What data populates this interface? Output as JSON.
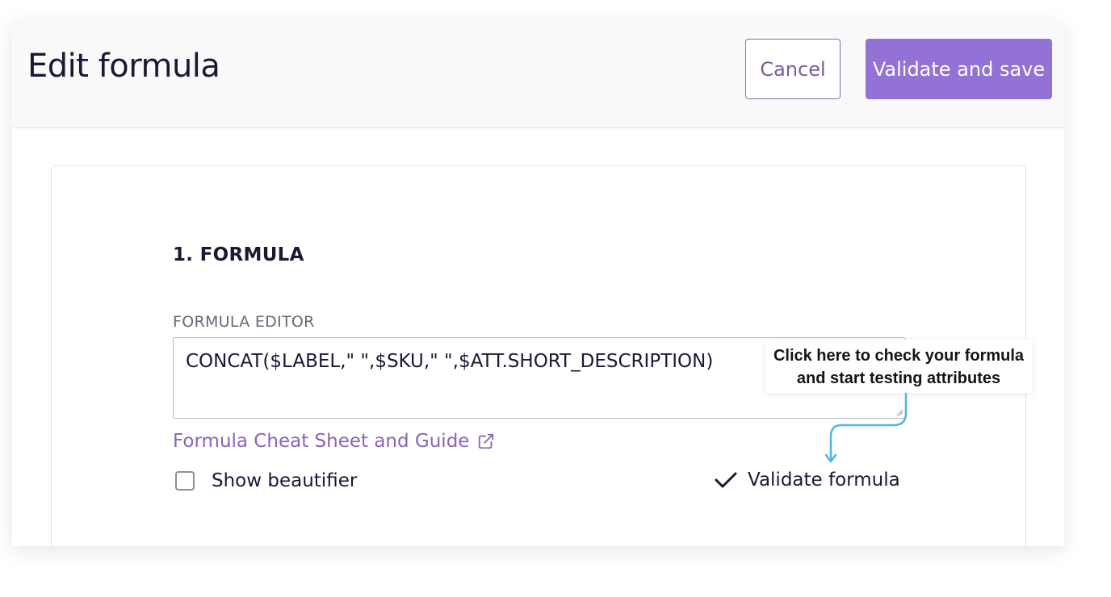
{
  "header": {
    "title": "Edit formula",
    "cancel_label": "Cancel",
    "save_label": "Validate and save"
  },
  "formula_section": {
    "title": "1. FORMULA",
    "editor_label": "FORMULA EDITOR",
    "editor_value": "CONCAT($LABEL,\" \",$SKU,\" \",$ATT.SHORT_DESCRIPTION)",
    "guide_link": "Formula Cheat Sheet and Guide",
    "guide_icon": "external-link-icon",
    "beautifier_label": "Show beautifier",
    "beautifier_checked": false,
    "validate_label": "Validate formula",
    "validate_icon": "check-icon"
  },
  "callout": {
    "line1": "Click here to check your formula",
    "line2": "and start testing attributes"
  },
  "colors": {
    "accent": "#9272d6",
    "link": "#8a64b6",
    "callout_arrow": "#4bb8e0"
  }
}
